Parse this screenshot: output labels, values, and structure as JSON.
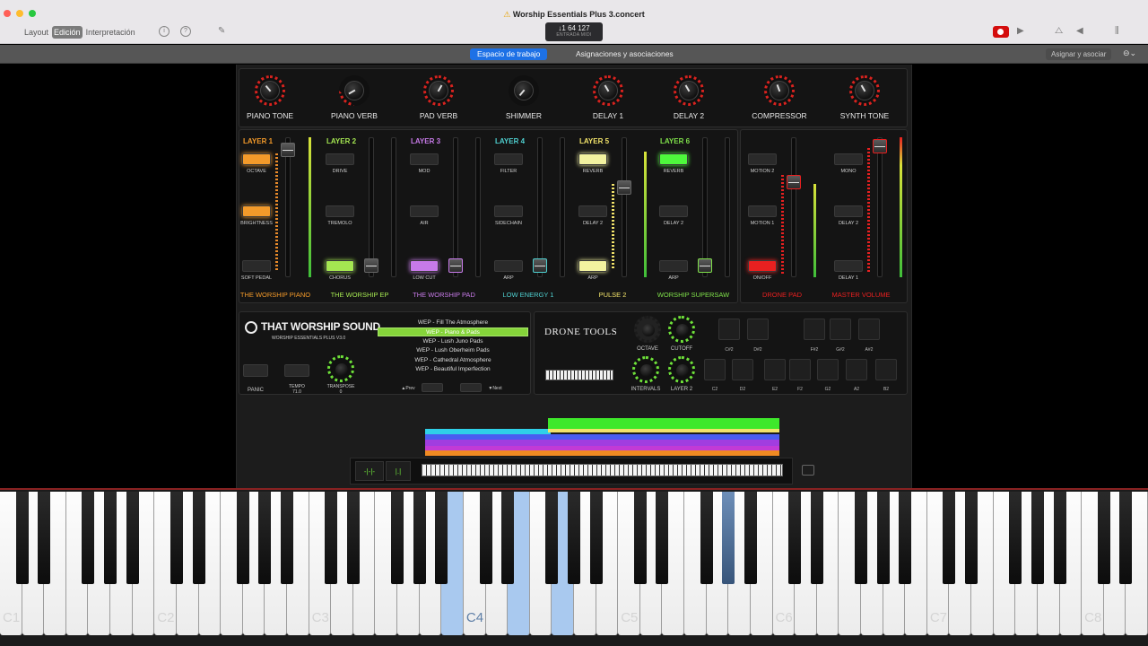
{
  "window": {
    "title": "Worship Essentials Plus 3.concert",
    "warning_glyph": "⚠"
  },
  "toolbar": {
    "modes": [
      "Layout",
      "Edición",
      "Interpretación"
    ],
    "active_mode": "Edición",
    "lcd": {
      "main": "↓1  64  127",
      "sub": "ENTRADA MIDI"
    }
  },
  "tabs": {
    "workspace": "Espacio de trabajo",
    "assignments": "Asignaciones y asociaciones",
    "assign_button": "Asignar y asociar"
  },
  "knobs": [
    "PIANO TONE",
    "PIANO VERB",
    "PAD VERB",
    "SHIMMER",
    "DELAY 1",
    "DELAY 2",
    "COMPRESSOR",
    "SYNTH TONE"
  ],
  "layers": [
    {
      "head": "LAYER 1",
      "color": "#f39a2a",
      "b1": "OCTAVE",
      "b2": "BRIGHTNESS",
      "b3": "SOFT PEDAL",
      "name": "THE WORSHIP PIANO"
    },
    {
      "head": "LAYER 2",
      "color": "#a4e651",
      "b1": "DRIVE",
      "b2": "TREMOLO",
      "b3": "CHORUS",
      "name": "THE WORSHIP EP"
    },
    {
      "head": "LAYER 3",
      "color": "#c77ae8",
      "b1": "MOD",
      "b2": "AIR",
      "b3": "LOW CUT",
      "name": "THE WORSHIP PAD"
    },
    {
      "head": "LAYER 4",
      "color": "#4fd0d0",
      "b1": "FILTER",
      "b2": "SIDECHAIN",
      "b3": "ARP",
      "name": "LOW ENERGY 1"
    },
    {
      "head": "LAYER 5",
      "color": "#f2e36a",
      "b1": "REVERB",
      "b2": "DELAY 2",
      "b3": "ARP",
      "name": "PULSE 2"
    },
    {
      "head": "LAYER 6",
      "color": "#7fe04a",
      "b1": "REVERB",
      "b2": "DELAY 2",
      "b3": "ARP",
      "name": "WORSHIP SUPERSAW"
    }
  ],
  "drone_pad": {
    "b1": "MOTION 2",
    "b2": "MOTION 1",
    "b3": "ON/OFF",
    "name": "DRONE PAD"
  },
  "master": {
    "b1": "MONO",
    "b2": "DELAY 2",
    "b3": "DELAY 1",
    "name": "MASTER VOLUME"
  },
  "brand": {
    "logo": "THAT WORSHIP SOUND",
    "sub": "WORSHIP ESSENTIALS PLUS V3.0"
  },
  "controls": {
    "panic": "PANIC",
    "tempo": "TEMPO",
    "tempo_value": "71.0",
    "transpose": "TRANSPOSE",
    "transpose_value": "0",
    "prev": "▲Prev",
    "next": "▼Next"
  },
  "presets": [
    "WEP - Fill The Atmosphere",
    "WEP - Piano & Pads",
    "WEP - Lush Juno Pads",
    "WEP - Lush Oberheim Pads",
    "WEP - Cathedral Atmosphere",
    "WEP - Beautiful Imperfection"
  ],
  "selected_preset": "WEP - Piano & Pads",
  "drone": {
    "title": "DRONE TOOLS",
    "octave": "OCTAVE",
    "cutoff": "CUTOFF",
    "intervals": "INTERVALS",
    "layer2": "LAYER 2",
    "sharp_pads": [
      "C#2",
      "D#2",
      "F#2",
      "G#2",
      "A#2"
    ],
    "natural_pads": [
      "C2",
      "D2",
      "E2",
      "F2",
      "G2",
      "A2",
      "B2"
    ]
  },
  "keyboard": {
    "octave_labels": [
      "C1",
      "C2",
      "C3",
      "C4",
      "C5",
      "C6",
      "C7",
      "C8"
    ],
    "active_label": "C4"
  }
}
